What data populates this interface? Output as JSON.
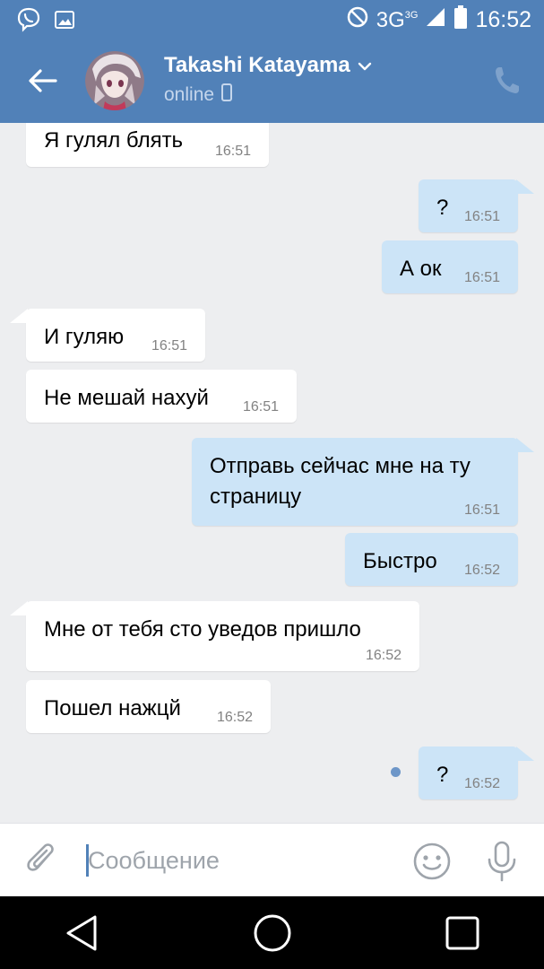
{
  "status_bar": {
    "network": "3G",
    "network_sup": "3G",
    "time": "16:52"
  },
  "header": {
    "name": "Takashi Katayama",
    "status": "online",
    "accent": "#5181b8"
  },
  "messages": [
    {
      "dir": "in",
      "text": "Я гулял блять",
      "time": "16:51"
    },
    {
      "dir": "out",
      "text": "?",
      "time": "16:51"
    },
    {
      "dir": "out",
      "text": "А ок",
      "time": "16:51"
    },
    {
      "dir": "in",
      "text": "И гуляю",
      "time": "16:51"
    },
    {
      "dir": "in",
      "text": "Не мешай нахуй",
      "time": "16:51"
    },
    {
      "dir": "out",
      "text": "Отправь сейчас мне на ту",
      "text2": "страницу",
      "time": "16:51"
    },
    {
      "dir": "out",
      "text": "Быстро",
      "time": "16:52"
    },
    {
      "dir": "in",
      "text": "Мне от тебя сто уведов пришло",
      "time": "16:52"
    },
    {
      "dir": "in",
      "text": "Пошел нажцй",
      "time": "16:52"
    },
    {
      "dir": "out",
      "text": "?",
      "time": "16:52",
      "unread": true
    }
  ],
  "composer": {
    "placeholder": "Сообщение"
  },
  "icons": {
    "status_left": [
      "viber-icon",
      "image-icon"
    ],
    "status_right": [
      "do-not-disturb-icon",
      "signal-icon",
      "battery-icon"
    ],
    "header": [
      "back-arrow-icon",
      "chevron-down-icon",
      "mobile-icon",
      "phone-icon"
    ],
    "composer": [
      "paperclip-icon",
      "emoji-icon",
      "microphone-icon"
    ],
    "navbar": [
      "nav-back-icon",
      "nav-home-icon",
      "nav-recent-icon"
    ]
  }
}
